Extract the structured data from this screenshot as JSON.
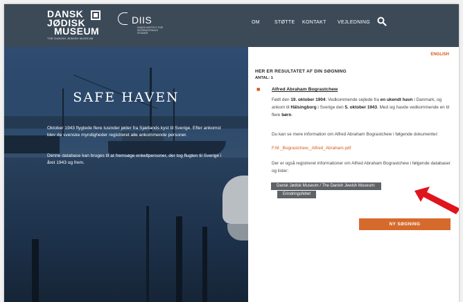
{
  "header": {
    "museum_logo": {
      "line1": "DANSK",
      "line2": "JØDISK",
      "line3": "MUSEUM",
      "sub": "THE DANISH JEWISH MUSEUM"
    },
    "diis_logo": {
      "name": "DIIS",
      "sub": "DANSK INSTITUT FOR INTERNATIONALE STUDIER"
    },
    "nav": [
      "OM",
      "STØTTE",
      "KONTAKT",
      "VEJLEDNING"
    ],
    "search_icon": "search-icon"
  },
  "hero": {
    "title": "SAFE HAVEN",
    "paragraph1": "Oktober 1943 flygtede flere tusinder jøder fra Sjællands kyst til Sverige. Efter ankomst blev de svenske myndigheder registreret alle ankommende personer.",
    "paragraph2": "Denne database kan bruges til at fremsøge enkeltpersoner, der tog flugten til Sverige i året 1943 og frem."
  },
  "panel": {
    "english_link": "ENGLISH",
    "result_heading": "HER ER RESULTATET AF DIN SØGNING",
    "result_count": "ANTAL: 1",
    "person_name": "Alfred Abraham Bograstchew",
    "bio": {
      "p1": "Født den ",
      "birth": "19. oktober 1904",
      "p2": ". Vedkommende sejlede fra ",
      "from": "en ukendt havn",
      "p3": " i Danmark, og ankom til ",
      "to": "Hälsingborg",
      "p4": " i Sverige den ",
      "date": "5. oktober 1943",
      "p5": ". Med sig havde vedkommende en til flere ",
      "kids": "børn",
      "p6": "."
    },
    "more_info": "Du kan se mere information om Alfred Abraham Bograstchew i følgende dokumenter:",
    "doc_link": "F.M._Bograstchew,_Alfred_Abraham.pdf",
    "registered": "Der er også registreret informationer om Alfred Abraham Bograstchew i følgende databaser og lister:",
    "db_tag1": "Dansk Jødisk Museum / The Danish Jewish Museum:",
    "db_tag2": "Erindringsfeltet",
    "new_search_label": "NY SØGNING"
  },
  "colors": {
    "header_bg": "#3c4a58",
    "accent": "#d45a1c",
    "button": "#d66a2c",
    "tag": "#5f6266",
    "arrow": "#e0141c"
  }
}
